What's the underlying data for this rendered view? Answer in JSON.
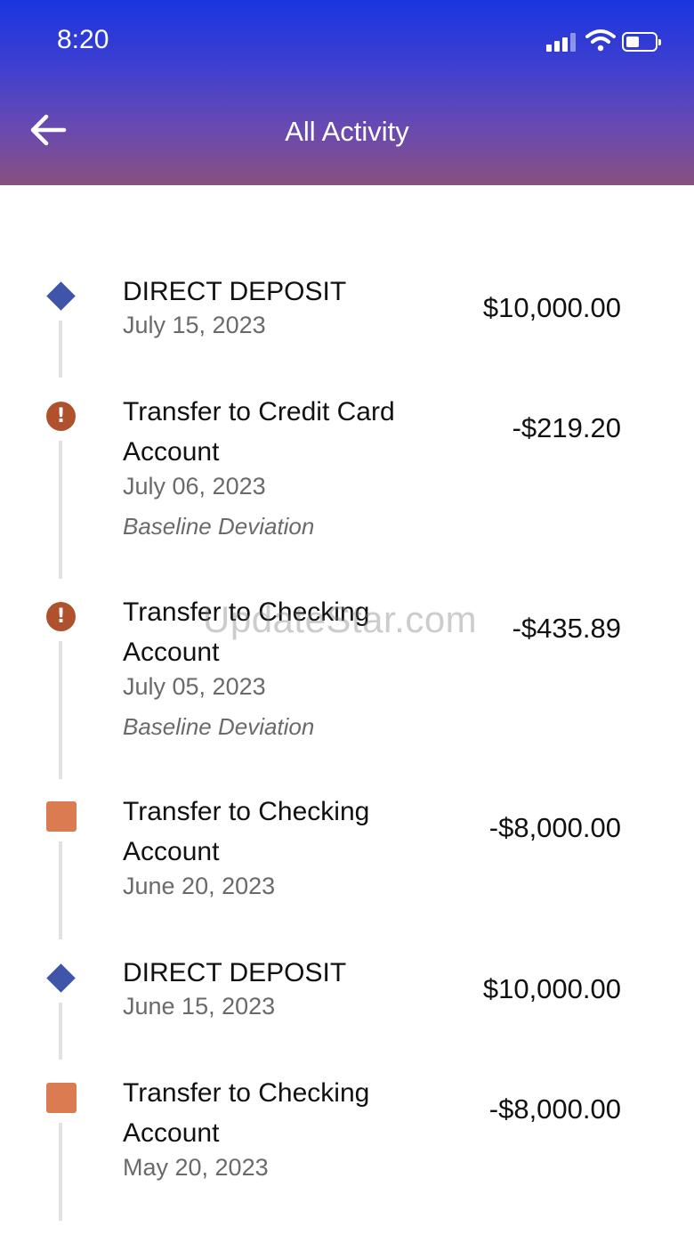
{
  "status_bar": {
    "time": "8:20"
  },
  "header": {
    "title": "All Activity"
  },
  "transactions": [
    {
      "name": "DIRECT DEPOSIT",
      "date": "July 15, 2023",
      "amount": "$10,000.00",
      "note": "",
      "icon": "diamond-icon"
    },
    {
      "name": "Transfer to Credit Card Account",
      "date": "July 06, 2023",
      "amount": "-$219.20",
      "note": "Baseline Deviation",
      "icon": "alert-icon"
    },
    {
      "name": "Transfer to Checking Account",
      "date": "July 05, 2023",
      "amount": "-$435.89",
      "note": "Baseline Deviation",
      "icon": "alert-icon"
    },
    {
      "name": "Transfer to Checking Account",
      "date": "June 20, 2023",
      "amount": "-$8,000.00",
      "note": "",
      "icon": "square-icon"
    },
    {
      "name": "DIRECT DEPOSIT",
      "date": "June 15, 2023",
      "amount": "$10,000.00",
      "note": "",
      "icon": "diamond-icon"
    },
    {
      "name": "Transfer to Checking Account",
      "date": "May 20, 2023",
      "amount": "-$8,000.00",
      "note": "",
      "icon": "square-icon"
    }
  ],
  "alert_glyph": "!",
  "watermark": "UpdateStar.com",
  "colors": {
    "deposit": "#3f55aa",
    "alert": "#b0512e",
    "transfer": "#db7b52"
  }
}
